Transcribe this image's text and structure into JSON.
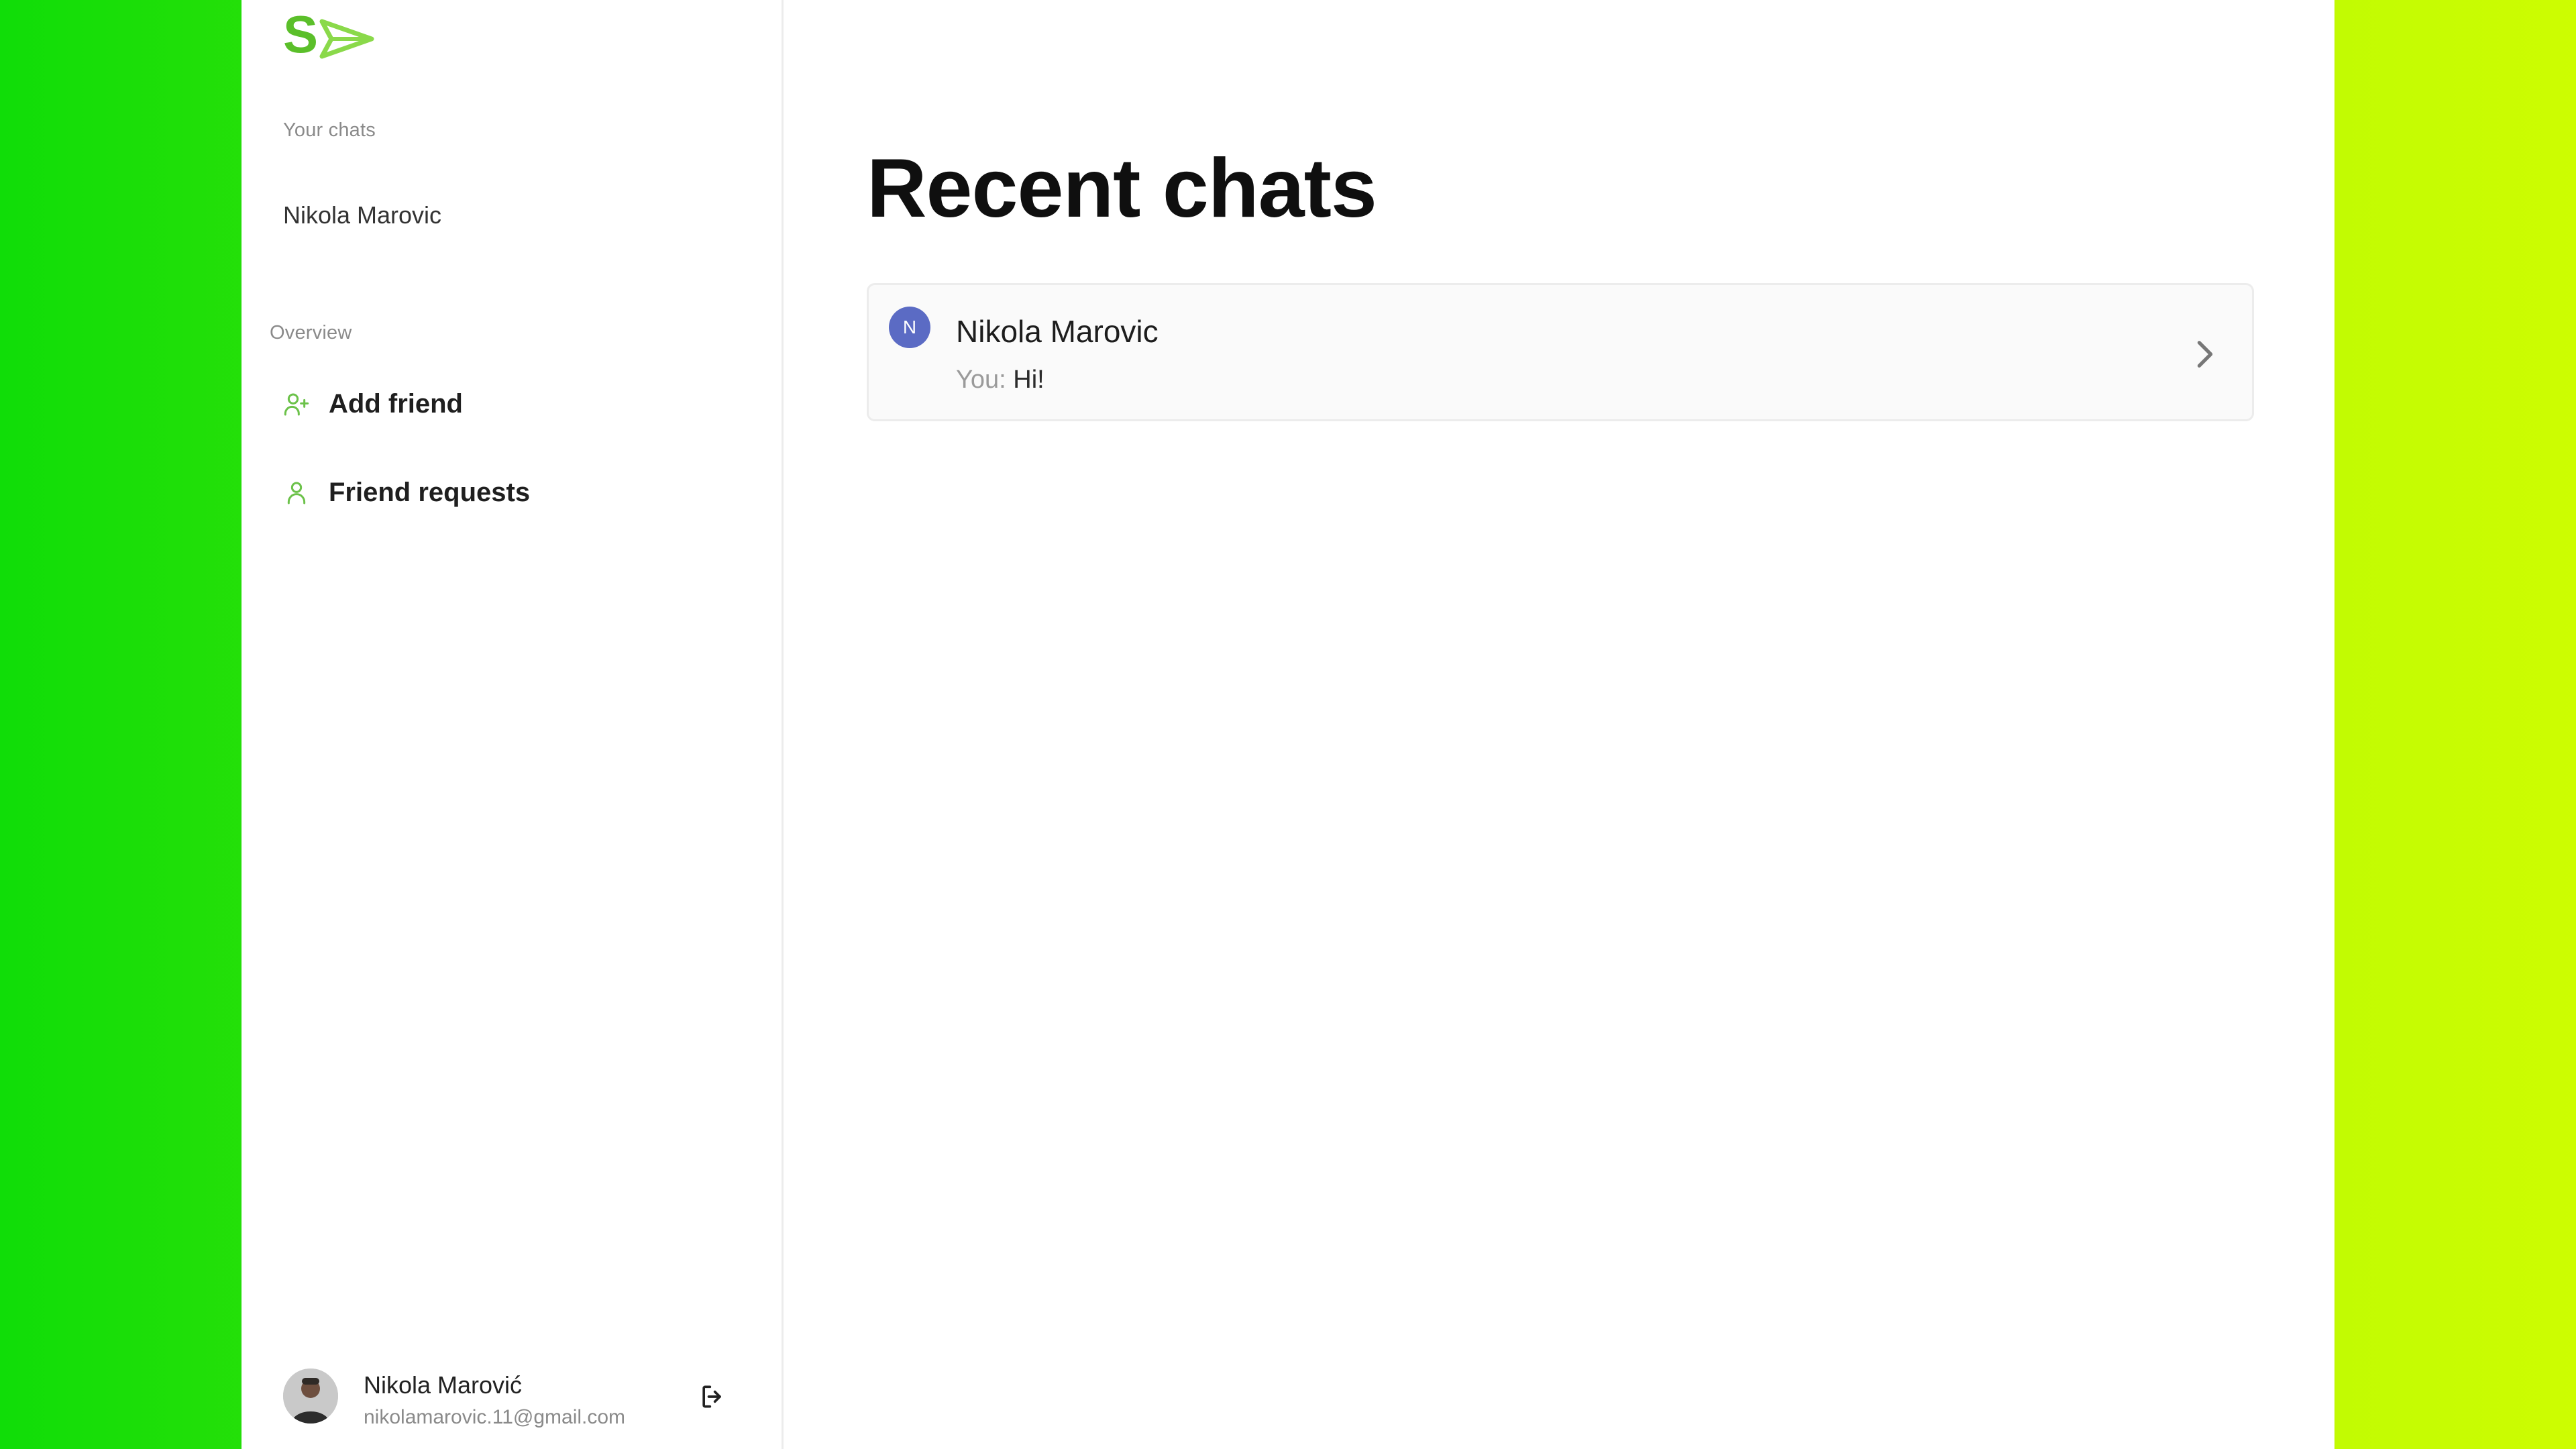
{
  "sidebar": {
    "logo_icon": "send-icon",
    "your_chats_label": "Your chats",
    "chats": [
      {
        "name": "Nikola Marovic"
      }
    ],
    "overview_label": "Overview",
    "nav": [
      {
        "label": "Add friend",
        "icon": "user-plus-icon"
      },
      {
        "label": "Friend requests",
        "icon": "user-icon"
      }
    ],
    "profile": {
      "name": "Nikola Marović",
      "email": "nikolamarovic.11@gmail.com",
      "logout_icon": "logout-icon"
    }
  },
  "main": {
    "title": "Recent chats",
    "recent_chats": [
      {
        "initial": "N",
        "name": "Nikola Marovic",
        "prefix": "You:",
        "message": "Hi!"
      }
    ]
  },
  "colors": {
    "accent_green": "#6cc24a",
    "avatar_blue": "#5b6bc4",
    "background_gradient_start": "#10dd08",
    "background_gradient_end": "#cdfd01"
  }
}
